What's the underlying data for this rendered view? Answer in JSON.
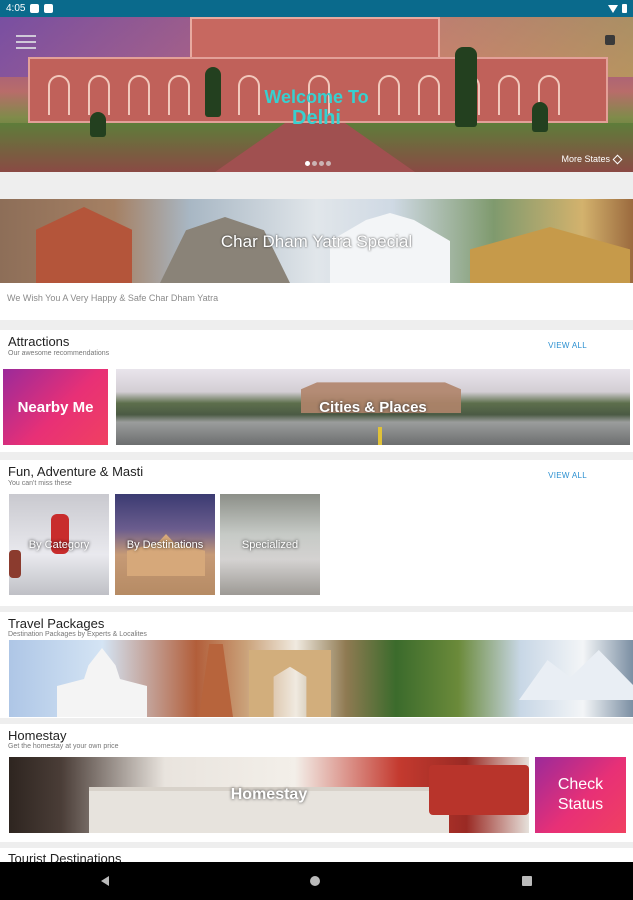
{
  "status_bar": {
    "time": "4:05"
  },
  "hero": {
    "welcome": "Welcome To",
    "city": "Delhi",
    "more_states": "More States"
  },
  "char_dham": {
    "title": "Char Dham Yatra Special",
    "subtitle": "We Wish You A Very Happy & Safe Char Dham Yatra"
  },
  "attractions": {
    "title": "Attractions",
    "subtitle": "Our awesome recommendations",
    "view_all": "VIEW ALL",
    "nearby": "Nearby Me",
    "cities": "Cities & Places"
  },
  "fun": {
    "title": "Fun, Adventure & Masti",
    "subtitle": "You can't miss these",
    "view_all": "VIEW ALL",
    "tiles": [
      "By Category",
      "By Destinations",
      "Specialized"
    ]
  },
  "packages": {
    "title": "Travel Packages",
    "subtitle": "Destination Packages by Experts & Localites"
  },
  "homestay": {
    "title": "Homestay",
    "subtitle": "Get the homestay at your own price",
    "banner": "Homestay",
    "check_status_line1": "Check",
    "check_status_line2": "Status"
  },
  "tourist": {
    "title": "Tourist Destinations"
  },
  "colors": {
    "status_bar": "#0a6a8c",
    "accent": "#2a8fd0",
    "gradient_start": "#9b2a9a",
    "gradient_end": "#f04061",
    "welcome_text": "#37d0d0"
  },
  "icons": [
    "menu-icon",
    "share-icon",
    "pencil-icon",
    "back-icon",
    "home-icon",
    "recents-icon"
  ]
}
